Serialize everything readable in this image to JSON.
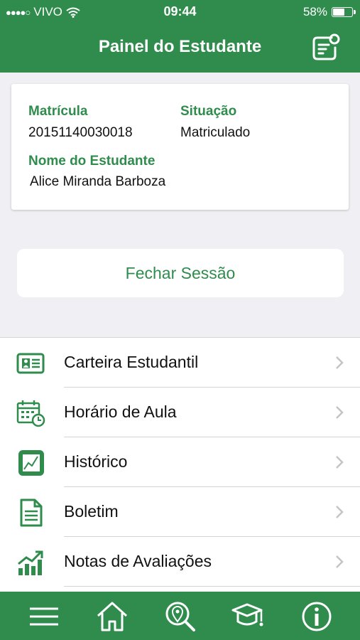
{
  "status_bar": {
    "signal": "●●●●○",
    "carrier": "VIVO",
    "time": "09:44",
    "battery_text": "58%",
    "battery_level": 0.58
  },
  "header": {
    "title": "Painel do Estudante",
    "action_icon": "logout-icon"
  },
  "student": {
    "matricula_label": "Matrícula",
    "matricula_value": "20151140030018",
    "situacao_label": "Situação",
    "situacao_value": "Matriculado",
    "nome_label": "Nome do Estudante",
    "nome_value": "Alice Miranda Barboza"
  },
  "close_session": "Fechar Sessão",
  "menu": [
    {
      "label": "Carteira Estudantil",
      "icon": "id-card-icon"
    },
    {
      "label": "Horário de Aula",
      "icon": "calendar-clock-icon"
    },
    {
      "label": "Histórico",
      "icon": "chart-icon"
    },
    {
      "label": "Boletim",
      "icon": "document-icon"
    },
    {
      "label": "Notas de Avaliações",
      "icon": "growth-chart-icon"
    }
  ],
  "tabbar": [
    "menu-icon",
    "home-icon",
    "location-search-icon",
    "graduation-cap-icon",
    "info-icon"
  ],
  "colors": {
    "brand": "#2f8c4d",
    "background": "#efeff4"
  }
}
